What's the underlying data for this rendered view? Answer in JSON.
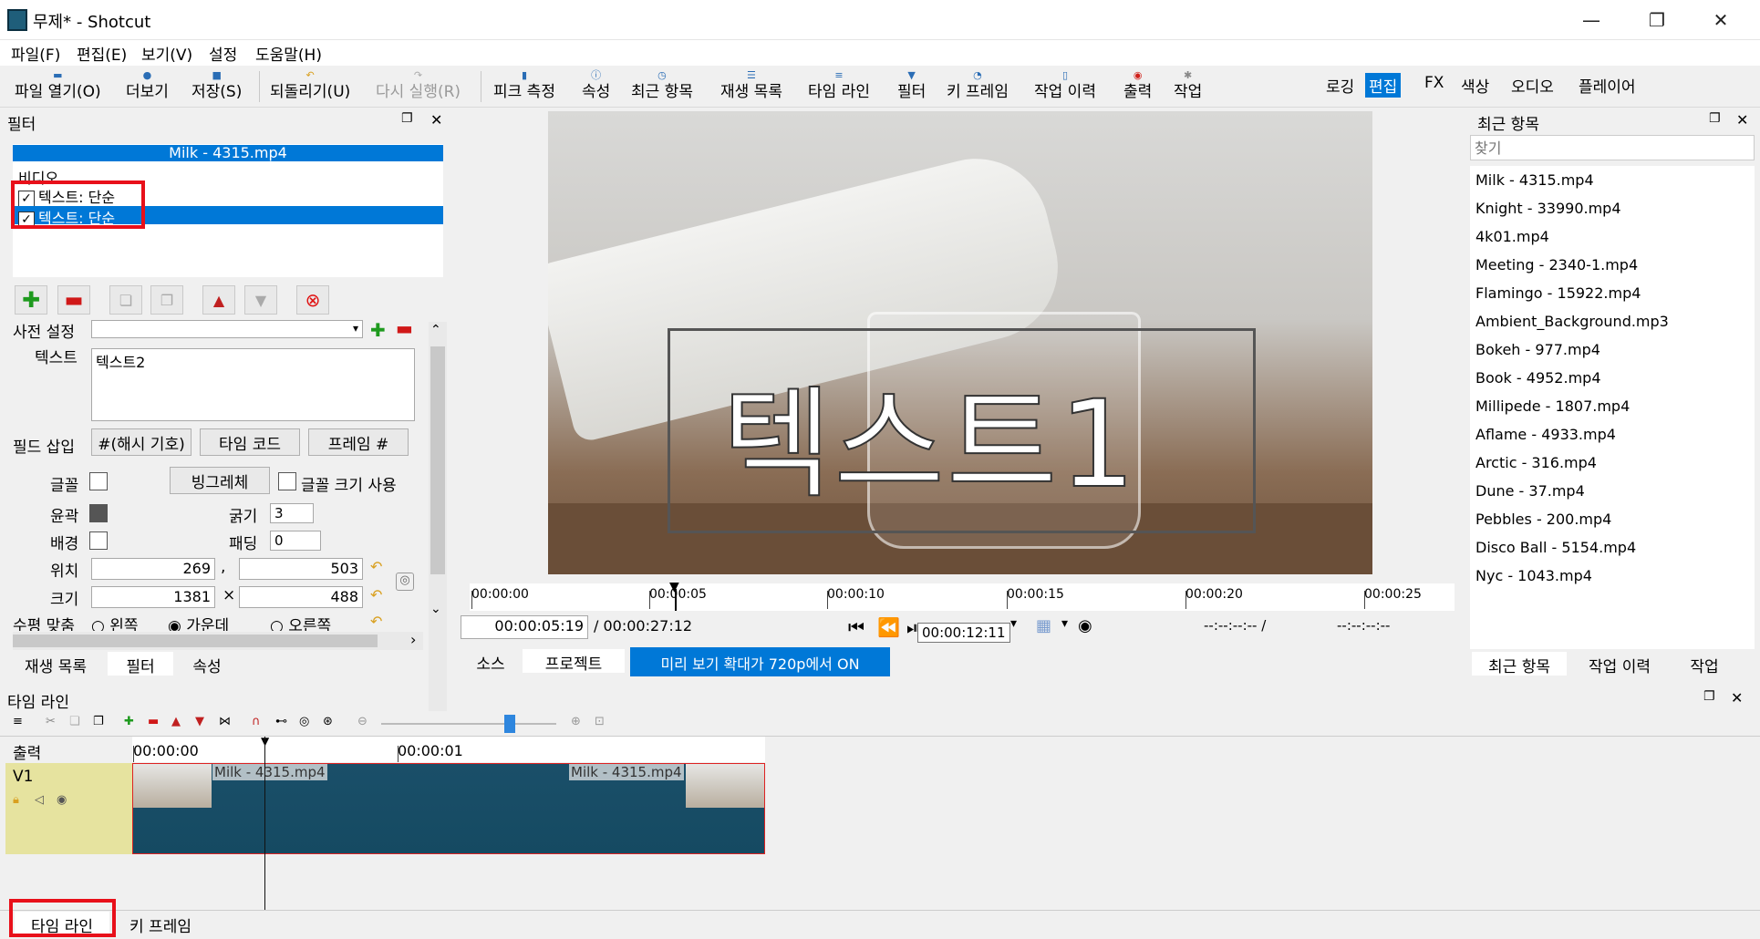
{
  "window": {
    "title": "무제* - Shotcut",
    "minimize": "—",
    "restore": "❐",
    "close": "✕"
  },
  "menu": [
    "파일(F)",
    "편집(E)",
    "보기(V)",
    "설정",
    "도움말(H)"
  ],
  "toolbar": {
    "open": "파일 열기(O)",
    "more": "더보기",
    "save": "저장(S)",
    "undo": "되돌리기(U)",
    "redo": "다시 실행(R)",
    "peak": "피크 측정",
    "properties": "속성",
    "recent": "최근 항목",
    "playlist": "재생 목록",
    "timeline": "타임 라인",
    "filters": "필터",
    "keyframes": "키 프레임",
    "history": "작업 이력",
    "export": "출력",
    "jobs": "작업"
  },
  "workspaces": [
    "로깅",
    "편집",
    "FX",
    "색상",
    "오디오",
    "플레이어"
  ],
  "workspace_active": "편집",
  "filter_panel": {
    "title": "필터",
    "clip_name": "Milk - 4315.mp4",
    "section": "비디오",
    "filters": [
      "텍스트: 단순",
      "텍스트: 단순"
    ],
    "selected_index": 1,
    "preset_label": "사전 설정",
    "text_label": "텍스트",
    "text_value": "텍스트2",
    "insert_field_label": "필드 삽입",
    "insert_buttons": [
      "#(해시 기호)",
      "타임 코드",
      "프레임 #"
    ],
    "font_label": "글꼴",
    "font_button": "빙그레체",
    "font_size_label": "글꼴 크기 사용",
    "outline_label": "윤곽",
    "thickness_label": "굵기",
    "thickness_value": "3",
    "background_label": "배경",
    "padding_label": "패딩",
    "padding_value": "0",
    "position_label": "위치",
    "position_x": "269",
    "position_sep": ",",
    "position_y": "503",
    "size_label": "크기",
    "size_w": "1381",
    "size_sep": "×",
    "size_h": "488",
    "halign_label": "수평 맞춤",
    "halign_options": [
      "왼쪽",
      "가운데",
      "오른쪽"
    ],
    "tabs": [
      "재생 목록",
      "필터",
      "속성"
    ],
    "active_tab": "필터"
  },
  "preview": {
    "overlay_text": "텍스트1",
    "ruler_labels": [
      "00:00:00",
      "00:00:05",
      "00:00:10",
      "00:00:15",
      "00:00:20",
      "00:00:25"
    ],
    "position": "00:00:05:19",
    "duration": "/ 00:00:27:12",
    "tooltip": "00:00:12:11",
    "in_out": "--:--:--:-- /",
    "out": "--:--:--:--",
    "tabs": [
      "소스",
      "프로젝트"
    ],
    "zoom_notice": "미리 보기 확대가 720p에서 ON"
  },
  "recent_panel": {
    "title": "최근 항목",
    "search_placeholder": "찾기",
    "items": [
      "Milk - 4315.mp4",
      "Knight - 33990.mp4",
      "4k01.mp4",
      "Meeting - 2340-1.mp4",
      "Flamingo - 15922.mp4",
      "Ambient_Background.mp3",
      "Bokeh - 977.mp4",
      "Book - 4952.mp4",
      "Millipede - 1807.mp4",
      "Aflame - 4933.mp4",
      "Arctic - 316.mp4",
      "Dune - 37.mp4",
      "Pebbles - 200.mp4",
      "Disco Ball - 5154.mp4",
      "Nyc - 1043.mp4"
    ],
    "tabs": [
      "최근 항목",
      "작업 이력",
      "작업"
    ]
  },
  "timeline": {
    "title": "타임 라인",
    "output_label": "출력",
    "ruler": [
      "00:00:00",
      "00:00:01"
    ],
    "track": "V1",
    "clip_labels": [
      "Milk - 4315.mp4",
      "Milk - 4315.mp4"
    ]
  },
  "bottom_tabs": [
    "타임 라인",
    "키 프레임"
  ]
}
